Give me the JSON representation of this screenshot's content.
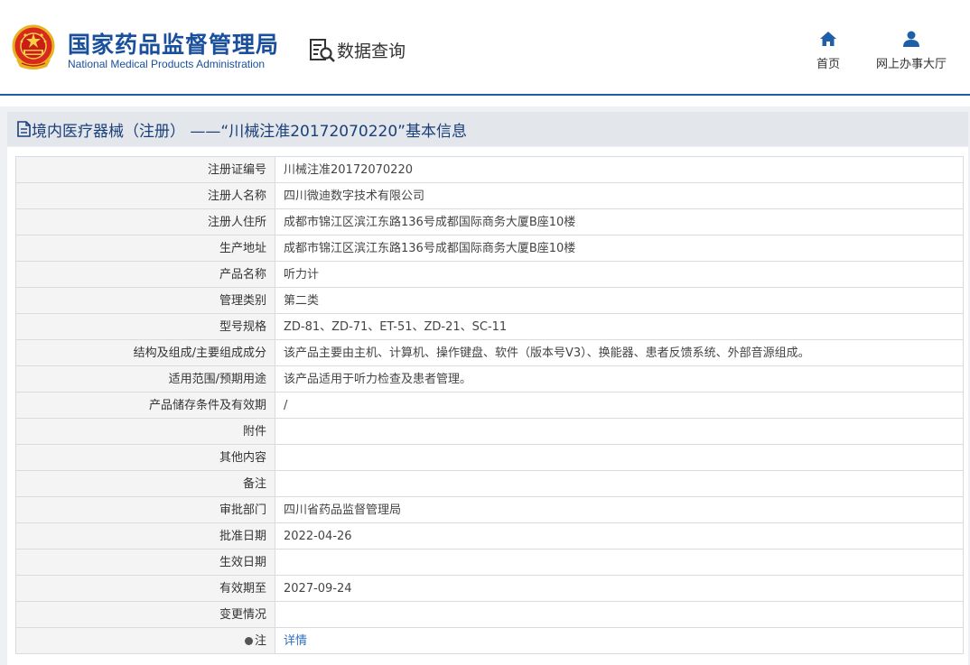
{
  "header": {
    "org_name_cn": "国家药品监督管理局",
    "org_name_en": "National Medical Products Administration",
    "section_title": "数据查询",
    "nav": [
      {
        "label": "首页",
        "icon": "home-icon"
      },
      {
        "label": "网上办事大厅",
        "icon": "user-icon"
      }
    ]
  },
  "page": {
    "title": "境内医疗器械（注册） ——“川械注准20172070220”基本信息",
    "title_icon": "document-icon"
  },
  "colors": {
    "brand_blue": "#1a4f9c",
    "header_line": "#1f5fa8",
    "link": "#2f6fc0",
    "label_bg": "#f4f4f5",
    "band_bg": "#eef0f3"
  },
  "table": {
    "rows": [
      {
        "label": "注册证编号",
        "value": "川械注准20172070220"
      },
      {
        "label": "注册人名称",
        "value": "四川微迪数字技术有限公司"
      },
      {
        "label": "注册人住所",
        "value": "成都市锦江区滨江东路136号成都国际商务大厦B座10楼"
      },
      {
        "label": "生产地址",
        "value": "成都市锦江区滨江东路136号成都国际商务大厦B座10楼"
      },
      {
        "label": "产品名称",
        "value": "听力计"
      },
      {
        "label": "管理类别",
        "value": "第二类"
      },
      {
        "label": "型号规格",
        "value": "ZD-81、ZD-71、ET-51、ZD-21、SC-11"
      },
      {
        "label": "结构及组成/主要组成成分",
        "value": "该产品主要由主机、计算机、操作键盘、软件（版本号V3）、换能器、患者反馈系统、外部音源组成。"
      },
      {
        "label": "适用范围/预期用途",
        "value": "该产品适用于听力检查及患者管理。"
      },
      {
        "label": "产品储存条件及有效期",
        "value": "/"
      },
      {
        "label": "附件",
        "value": ""
      },
      {
        "label": "其他内容",
        "value": ""
      },
      {
        "label": "备注",
        "value": ""
      },
      {
        "label": "审批部门",
        "value": "四川省药品监督管理局"
      },
      {
        "label": "批准日期",
        "value": "2022-04-26"
      },
      {
        "label": "生效日期",
        "value": ""
      },
      {
        "label": "有效期至",
        "value": "2027-09-24"
      },
      {
        "label": "变更情况",
        "value": ""
      }
    ],
    "note_row": {
      "label": "注",
      "link_text": "详情",
      "icon": "note-dot-icon"
    }
  }
}
